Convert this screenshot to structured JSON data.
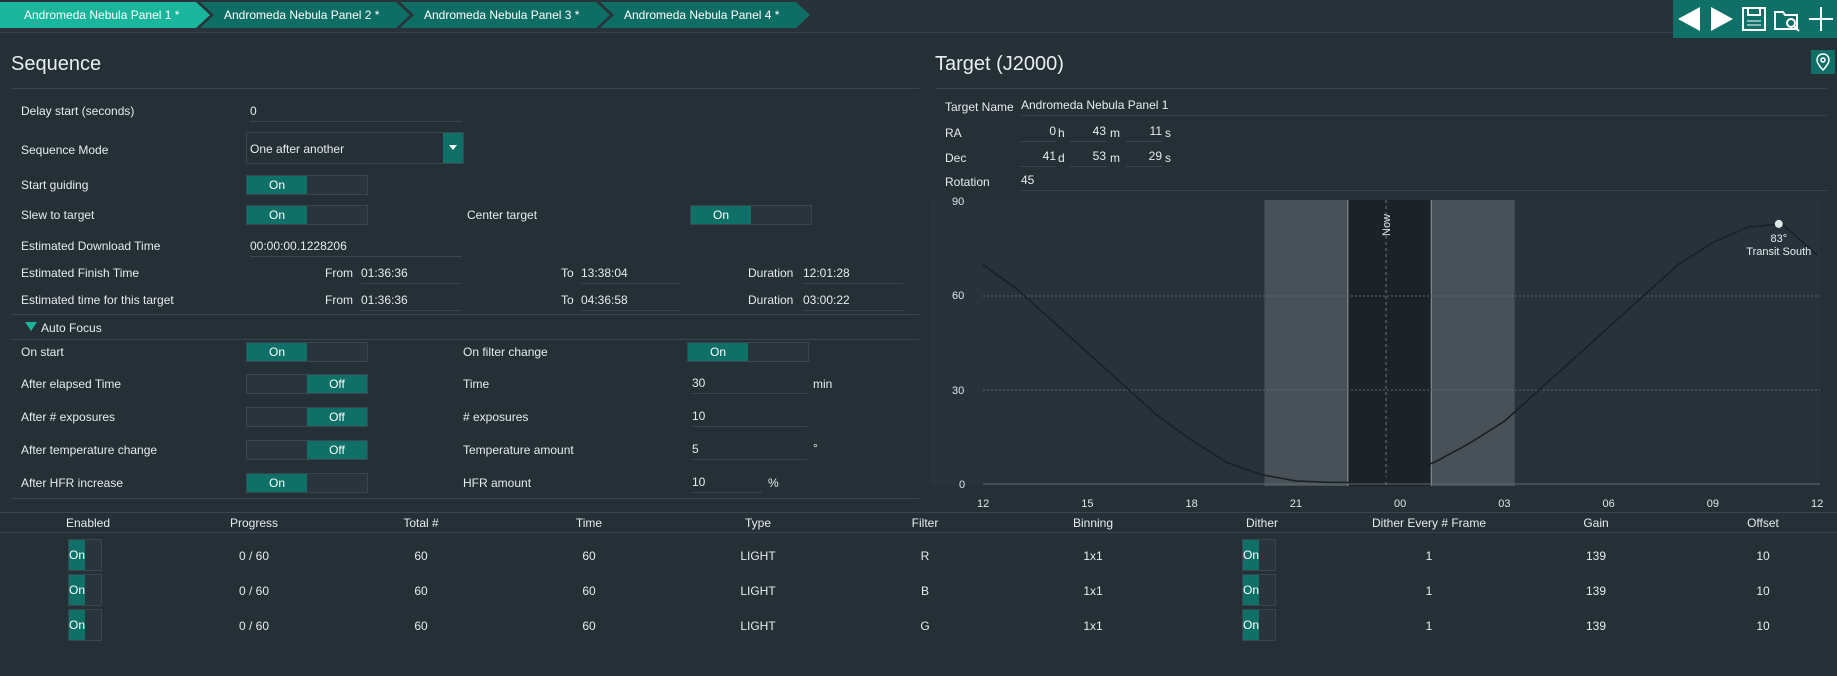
{
  "tabs": [
    "Andromeda Nebula Panel 1 *",
    "Andromeda Nebula Panel 2 *",
    "Andromeda Nebula Panel 3 *",
    "Andromeda Nebula Panel 4 *"
  ],
  "toolbar_icons": [
    "arrow-left-icon",
    "arrow-right-icon",
    "save-icon",
    "folder-search-icon",
    "plus-icon"
  ],
  "sequence": {
    "title": "Sequence",
    "delay_label": "Delay start (seconds)",
    "delay_value": "0",
    "mode_label": "Sequence Mode",
    "mode_value": "One after another",
    "start_guiding_label": "Start guiding",
    "slew_label": "Slew to target",
    "center_label": "Center target",
    "download_label": "Estimated Download Time",
    "download_value": "00:00:00.1228206",
    "finish_label": "Estimated Finish Time",
    "target_time_label": "Estimated time for this target",
    "from_label": "From",
    "to_label": "To",
    "duration_label": "Duration",
    "finish_from": "01:36:36",
    "finish_to": "13:38:04",
    "finish_duration": "12:01:28",
    "target_from": "01:36:36",
    "target_to": "04:36:58",
    "target_duration": "03:00:22",
    "on": "On",
    "off": "Off"
  },
  "autofocus": {
    "title": "Auto Focus",
    "on_start": "On start",
    "after_elapsed": "After elapsed Time",
    "after_exposures": "After # exposures",
    "after_temp": "After temperature change",
    "after_hfr": "After HFR increase",
    "on_filter_change": "On filter change",
    "time_label": "Time",
    "time_value": "30",
    "time_unit": "min",
    "exposures_label": "# exposures",
    "exposures_value": "10",
    "temp_label": "Temperature amount",
    "temp_value": "5",
    "temp_unit": "°",
    "hfr_label": "HFR amount",
    "hfr_value": "10",
    "hfr_unit": "%"
  },
  "target": {
    "title": "Target (J2000)",
    "name_label": "Target Name",
    "name_value": "Andromeda Nebula Panel 1",
    "ra_label": "RA",
    "ra_h": "0",
    "ra_h_unit": "h",
    "ra_m": "43",
    "ra_m_unit": "m",
    "ra_s": "11",
    "ra_s_unit": "s",
    "dec_label": "Dec",
    "dec_d": "41",
    "dec_d_unit": "d",
    "dec_m": "53",
    "dec_m_unit": "m",
    "dec_s": "29",
    "dec_s_unit": "s",
    "rotation_label": "Rotation",
    "rotation_value": "45"
  },
  "chart_data": {
    "type": "line",
    "x_ticks": [
      "12",
      "15",
      "18",
      "21",
      "00",
      "03",
      "06",
      "09",
      "12"
    ],
    "y_ticks": [
      "0",
      "30",
      "60",
      "90"
    ],
    "ylim": [
      0,
      90
    ],
    "x_hours": [
      12,
      13,
      14,
      15,
      16,
      17,
      18,
      19,
      20,
      21,
      22,
      23,
      24,
      25,
      26,
      27,
      28,
      29,
      30,
      31,
      32,
      33,
      34,
      35,
      36
    ],
    "altitude": [
      70,
      62,
      52,
      42,
      32,
      22,
      14,
      7,
      3,
      1,
      0.5,
      0.5,
      3,
      7,
      13,
      20,
      30,
      40,
      50,
      60,
      70,
      77,
      82,
      83,
      73
    ],
    "now_label": "Now",
    "transit_label": "Transit South",
    "transit_alt_label": "83°",
    "night_bands": [
      "twilight",
      "night",
      "twilight"
    ]
  },
  "table": {
    "headers": [
      "Enabled",
      "Progress",
      "Total #",
      "Time",
      "Type",
      "Filter",
      "Binning",
      "Dither",
      "Dither Every # Frame",
      "Gain",
      "Offset"
    ],
    "rows": [
      {
        "enabled": "On",
        "progress": "0 / 60",
        "total": "60",
        "time": "60",
        "type": "LIGHT",
        "filter": "R",
        "binning": "1x1",
        "dither": "On",
        "dither_every": "1",
        "gain": "139",
        "offset": "10"
      },
      {
        "enabled": "On",
        "progress": "0 / 60",
        "total": "60",
        "time": "60",
        "type": "LIGHT",
        "filter": "B",
        "binning": "1x1",
        "dither": "On",
        "dither_every": "1",
        "gain": "139",
        "offset": "10"
      },
      {
        "enabled": "On",
        "progress": "0 / 60",
        "total": "60",
        "time": "60",
        "type": "LIGHT",
        "filter": "G",
        "binning": "1x1",
        "dither": "On",
        "dither_every": "1",
        "gain": "139",
        "offset": "10"
      }
    ]
  }
}
